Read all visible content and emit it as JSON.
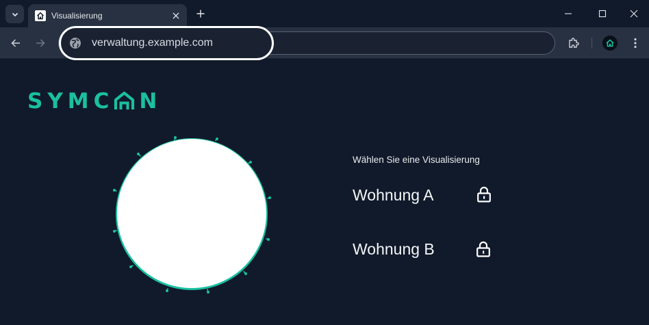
{
  "browser": {
    "tab": {
      "title": "Visualisierung"
    },
    "address_bar": {
      "url": "verwaltung.example.com"
    }
  },
  "page": {
    "logo": {
      "left": "SYMC",
      "right": "N"
    },
    "prompt": "Wählen Sie eine Visualisierung",
    "apartments": [
      {
        "label": "Wohnung A",
        "icon": "lock-icon"
      },
      {
        "label": "Wohnung B",
        "icon": "lock-icon"
      }
    ]
  },
  "colors": {
    "background": "#111a2a",
    "accent": "#1ac0a0",
    "toolbar": "#283142"
  }
}
